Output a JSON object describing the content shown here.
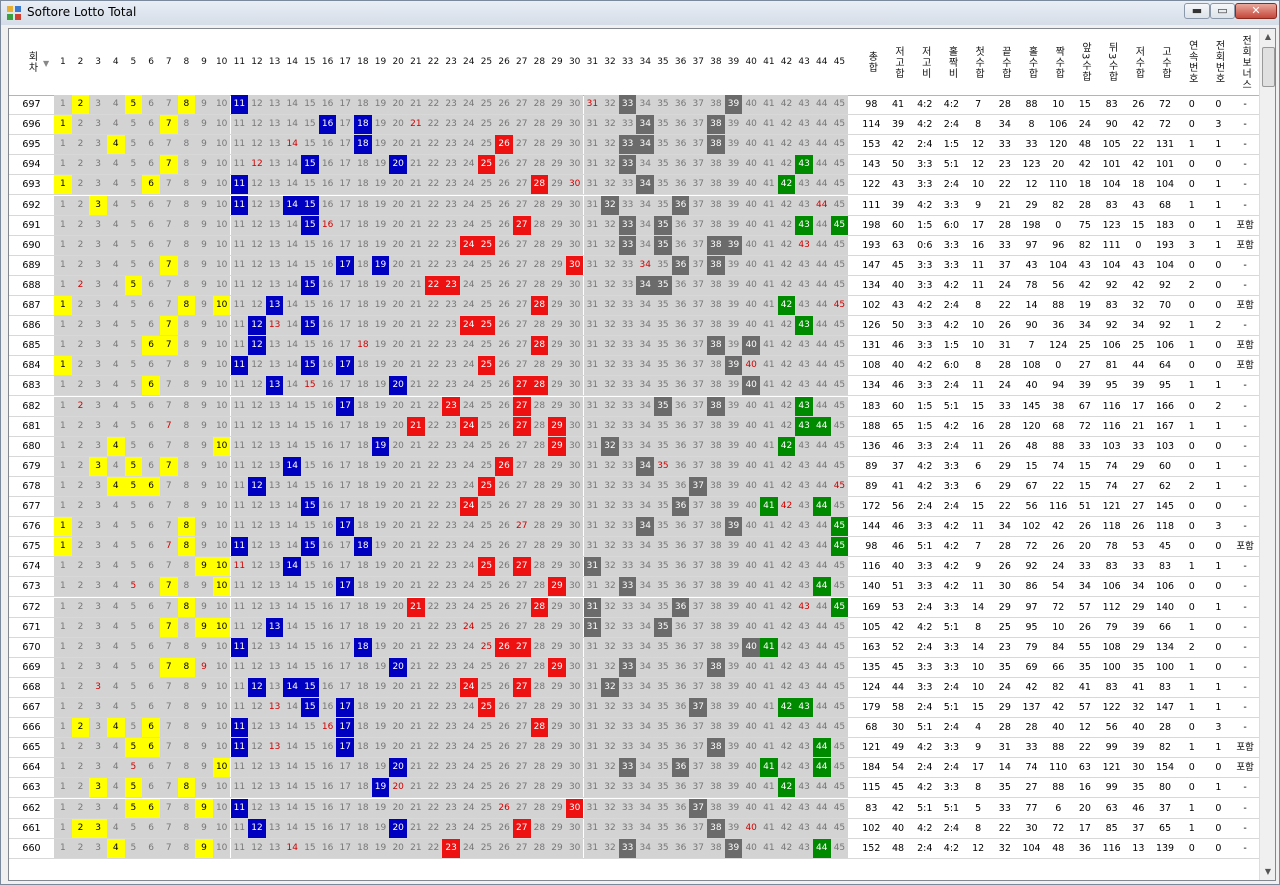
{
  "window": {
    "title": "Softore Lotto Total",
    "min_label": "▬",
    "max_label": "▭",
    "close_label": "✕"
  },
  "columns": {
    "round": "회차",
    "numbers": [
      "1",
      "2",
      "3",
      "4",
      "5",
      "6",
      "7",
      "8",
      "9",
      "10",
      "11",
      "12",
      "13",
      "14",
      "15",
      "16",
      "17",
      "18",
      "19",
      "20",
      "21",
      "22",
      "23",
      "24",
      "25",
      "26",
      "27",
      "28",
      "29",
      "30",
      "31",
      "32",
      "33",
      "34",
      "35",
      "36",
      "37",
      "38",
      "39",
      "40",
      "41",
      "42",
      "43",
      "44",
      "45"
    ],
    "stats": [
      "총합",
      "저고합",
      "저고비",
      "홀짝비",
      "첫수합",
      "끝수합",
      "홀수합",
      "짝수합",
      "앞3수합",
      "뒤3수합",
      "저수합",
      "고수합",
      "연속번호",
      "전회번호",
      "전회보너스"
    ]
  },
  "legend_colors": {
    "y": "#ffff00",
    "b": "#0000c0",
    "r": "#ee1111",
    "g": "#6b6b6b",
    "gr": "#008a00"
  },
  "rows": [
    {
      "round": "697",
      "hits": {
        "2": "y",
        "5": "y",
        "8": "y",
        "11": "b",
        "33": "g",
        "39": "g"
      },
      "red": [
        31
      ],
      "stats": [
        "98",
        "41",
        "4:2",
        "4:2",
        "7",
        "28",
        "88",
        "10",
        "15",
        "83",
        "26",
        "72",
        "0",
        "0",
        "-"
      ]
    },
    {
      "round": "696",
      "hits": {
        "1": "y",
        "7": "y",
        "16": "b",
        "18": "b",
        "34": "g",
        "38": "g"
      },
      "red": [
        21
      ],
      "stats": [
        "114",
        "39",
        "4:2",
        "2:4",
        "8",
        "34",
        "8",
        "106",
        "24",
        "90",
        "42",
        "72",
        "0",
        "3",
        "-"
      ]
    },
    {
      "round": "695",
      "hits": {
        "4": "y",
        "18": "b",
        "26": "r",
        "33": "g",
        "34": "g",
        "38": "g"
      },
      "red": [
        14
      ],
      "stats": [
        "153",
        "42",
        "2:4",
        "1:5",
        "12",
        "33",
        "33",
        "120",
        "48",
        "105",
        "22",
        "131",
        "1",
        "1",
        "-"
      ]
    },
    {
      "round": "694",
      "hits": {
        "7": "y",
        "15": "b",
        "20": "b",
        "25": "r",
        "33": "g",
        "43": "gr"
      },
      "red": [
        12
      ],
      "stats": [
        "143",
        "50",
        "3:3",
        "5:1",
        "12",
        "23",
        "123",
        "20",
        "42",
        "101",
        "42",
        "101",
        "0",
        "0",
        "-"
      ]
    },
    {
      "round": "693",
      "hits": {
        "1": "y",
        "6": "y",
        "11": "b",
        "28": "r",
        "34": "g",
        "42": "gr"
      },
      "red": [
        30
      ],
      "stats": [
        "122",
        "43",
        "3:3",
        "2:4",
        "10",
        "22",
        "12",
        "110",
        "18",
        "104",
        "18",
        "104",
        "0",
        "1",
        "-"
      ]
    },
    {
      "round": "692",
      "hits": {
        "3": "y",
        "11": "b",
        "14": "b",
        "15": "b",
        "32": "g",
        "36": "g"
      },
      "red": [
        44
      ],
      "stats": [
        "111",
        "39",
        "4:2",
        "3:3",
        "9",
        "21",
        "29",
        "82",
        "28",
        "83",
        "43",
        "68",
        "1",
        "1",
        "-"
      ]
    },
    {
      "round": "691",
      "hits": {
        "15": "b",
        "27": "r",
        "33": "g",
        "35": "g",
        "43": "gr",
        "45": "gr"
      },
      "red": [
        16
      ],
      "stats": [
        "198",
        "60",
        "1:5",
        "6:0",
        "17",
        "28",
        "198",
        "0",
        "75",
        "123",
        "15",
        "183",
        "0",
        "1",
        "포함"
      ]
    },
    {
      "round": "690",
      "hits": {
        "24": "r",
        "25": "r",
        "33": "g",
        "35": "g",
        "38": "g",
        "39": "g"
      },
      "red": [
        43
      ],
      "stats": [
        "193",
        "63",
        "0:6",
        "3:3",
        "16",
        "33",
        "97",
        "96",
        "82",
        "111",
        "0",
        "193",
        "3",
        "1",
        "포함"
      ]
    },
    {
      "round": "689",
      "hits": {
        "7": "y",
        "17": "b",
        "19": "b",
        "30": "r",
        "36": "g",
        "38": "g"
      },
      "red": [
        34
      ],
      "stats": [
        "147",
        "45",
        "3:3",
        "3:3",
        "11",
        "37",
        "43",
        "104",
        "43",
        "104",
        "43",
        "104",
        "0",
        "0",
        "-"
      ]
    },
    {
      "round": "688",
      "hits": {
        "5": "y",
        "15": "b",
        "22": "r",
        "23": "r",
        "34": "g",
        "35": "g"
      },
      "red": [
        2
      ],
      "stats": [
        "134",
        "40",
        "3:3",
        "4:2",
        "11",
        "24",
        "78",
        "56",
        "42",
        "92",
        "42",
        "92",
        "2",
        "0",
        "-"
      ]
    },
    {
      "round": "687",
      "hits": {
        "1": "y",
        "8": "y",
        "10": "y",
        "13": "b",
        "28": "r",
        "42": "gr"
      },
      "red": [
        45
      ],
      "stats": [
        "102",
        "43",
        "4:2",
        "2:4",
        "8",
        "22",
        "14",
        "88",
        "19",
        "83",
        "32",
        "70",
        "0",
        "0",
        "포함"
      ]
    },
    {
      "round": "686",
      "hits": {
        "7": "y",
        "12": "b",
        "15": "b",
        "24": "r",
        "25": "r",
        "43": "gr"
      },
      "red": [
        13
      ],
      "stats": [
        "126",
        "50",
        "3:3",
        "4:2",
        "10",
        "26",
        "90",
        "36",
        "34",
        "92",
        "34",
        "92",
        "1",
        "2",
        "-"
      ]
    },
    {
      "round": "685",
      "hits": {
        "6": "y",
        "7": "y",
        "12": "b",
        "28": "r",
        "38": "g",
        "40": "g"
      },
      "red": [
        18
      ],
      "stats": [
        "131",
        "46",
        "3:3",
        "1:5",
        "10",
        "31",
        "7",
        "124",
        "25",
        "106",
        "25",
        "106",
        "1",
        "0",
        "포함"
      ]
    },
    {
      "round": "684",
      "hits": {
        "1": "y",
        "11": "b",
        "15": "b",
        "17": "b",
        "25": "r",
        "39": "g"
      },
      "red": [
        40
      ],
      "stats": [
        "108",
        "40",
        "4:2",
        "6:0",
        "8",
        "28",
        "108",
        "0",
        "27",
        "81",
        "44",
        "64",
        "0",
        "0",
        "포함"
      ]
    },
    {
      "round": "683",
      "hits": {
        "6": "y",
        "13": "b",
        "20": "b",
        "27": "r",
        "28": "r",
        "40": "g"
      },
      "red": [
        15
      ],
      "stats": [
        "134",
        "46",
        "3:3",
        "2:4",
        "11",
        "24",
        "40",
        "94",
        "39",
        "95",
        "39",
        "95",
        "1",
        "1",
        "-"
      ]
    },
    {
      "round": "682",
      "hits": {
        "17": "b",
        "23": "r",
        "27": "r",
        "35": "g",
        "38": "g",
        "43": "gr"
      },
      "red": [
        2
      ],
      "stats": [
        "183",
        "60",
        "1:5",
        "5:1",
        "15",
        "33",
        "145",
        "38",
        "67",
        "116",
        "17",
        "166",
        "0",
        "2",
        "-"
      ]
    },
    {
      "round": "681",
      "hits": {
        "21": "r",
        "24": "r",
        "27": "r",
        "29": "r",
        "43": "gr",
        "44": "gr"
      },
      "red": [
        7
      ],
      "stats": [
        "188",
        "65",
        "1:5",
        "4:2",
        "16",
        "28",
        "120",
        "68",
        "72",
        "116",
        "21",
        "167",
        "1",
        "1",
        "-"
      ]
    },
    {
      "round": "680",
      "hits": {
        "4": "y",
        "10": "y",
        "19": "b",
        "29": "r",
        "32": "g",
        "42": "gr"
      },
      "red": [],
      "stats": [
        "136",
        "46",
        "3:3",
        "2:4",
        "11",
        "26",
        "48",
        "88",
        "33",
        "103",
        "33",
        "103",
        "0",
        "0",
        "-"
      ]
    },
    {
      "round": "679",
      "hits": {
        "3": "y",
        "5": "y",
        "7": "y",
        "14": "b",
        "26": "r",
        "34": "g"
      },
      "red": [
        35
      ],
      "stats": [
        "89",
        "37",
        "4:2",
        "3:3",
        "6",
        "29",
        "15",
        "74",
        "15",
        "74",
        "29",
        "60",
        "0",
        "1",
        "-"
      ]
    },
    {
      "round": "678",
      "hits": {
        "4": "y",
        "5": "y",
        "6": "y",
        "12": "b",
        "25": "r",
        "37": "g"
      },
      "red": [
        45
      ],
      "stats": [
        "89",
        "41",
        "4:2",
        "3:3",
        "6",
        "29",
        "67",
        "22",
        "15",
        "74",
        "27",
        "62",
        "2",
        "1",
        "-"
      ]
    },
    {
      "round": "677",
      "hits": {
        "15": "b",
        "24": "r",
        "36": "g",
        "41": "gr",
        "44": "gr"
      },
      "red": [
        42
      ],
      "stats": [
        "172",
        "56",
        "2:4",
        "2:4",
        "15",
        "22",
        "56",
        "116",
        "51",
        "121",
        "27",
        "145",
        "0",
        "0",
        "-"
      ]
    },
    {
      "round": "676",
      "hits": {
        "1": "y",
        "8": "y",
        "17": "b",
        "34": "g",
        "39": "g",
        "45": "gr"
      },
      "red": [
        27
      ],
      "stats": [
        "144",
        "46",
        "3:3",
        "4:2",
        "11",
        "34",
        "102",
        "42",
        "26",
        "118",
        "26",
        "118",
        "0",
        "3",
        "-"
      ]
    },
    {
      "round": "675",
      "hits": {
        "1": "y",
        "8": "y",
        "11": "b",
        "15": "b",
        "18": "b",
        "45": "gr"
      },
      "red": [
        7
      ],
      "stats": [
        "98",
        "46",
        "5:1",
        "4:2",
        "7",
        "28",
        "72",
        "26",
        "20",
        "78",
        "53",
        "45",
        "0",
        "0",
        "포함"
      ]
    },
    {
      "round": "674",
      "hits": {
        "9": "y",
        "10": "y",
        "14": "b",
        "25": "r",
        "27": "r",
        "31": "g"
      },
      "red": [
        11
      ],
      "stats": [
        "116",
        "40",
        "3:3",
        "4:2",
        "9",
        "26",
        "92",
        "24",
        "33",
        "83",
        "33",
        "83",
        "1",
        "1",
        "-"
      ]
    },
    {
      "round": "673",
      "hits": {
        "7": "y",
        "10": "y",
        "17": "b",
        "29": "r",
        "33": "g",
        "44": "gr"
      },
      "red": [
        5
      ],
      "stats": [
        "140",
        "51",
        "3:3",
        "4:2",
        "11",
        "30",
        "86",
        "54",
        "34",
        "106",
        "34",
        "106",
        "0",
        "0",
        "-"
      ]
    },
    {
      "round": "672",
      "hits": {
        "8": "y",
        "21": "r",
        "28": "r",
        "31": "g",
        "36": "g",
        "45": "gr"
      },
      "red": [
        43
      ],
      "stats": [
        "169",
        "53",
        "2:4",
        "3:3",
        "14",
        "29",
        "97",
        "72",
        "57",
        "112",
        "29",
        "140",
        "0",
        "1",
        "-"
      ]
    },
    {
      "round": "671",
      "hits": {
        "7": "y",
        "9": "y",
        "10": "y",
        "13": "b",
        "31": "g",
        "35": "g"
      },
      "red": [
        24
      ],
      "stats": [
        "105",
        "42",
        "4:2",
        "5:1",
        "8",
        "25",
        "95",
        "10",
        "26",
        "79",
        "39",
        "66",
        "1",
        "0",
        "-"
      ]
    },
    {
      "round": "670",
      "hits": {
        "11": "b",
        "18": "b",
        "26": "r",
        "27": "r",
        "40": "g",
        "41": "gr"
      },
      "red": [
        25
      ],
      "stats": [
        "163",
        "52",
        "2:4",
        "3:3",
        "14",
        "23",
        "79",
        "84",
        "55",
        "108",
        "29",
        "134",
        "2",
        "0",
        "-"
      ]
    },
    {
      "round": "669",
      "hits": {
        "7": "y",
        "8": "y",
        "20": "b",
        "29": "r",
        "33": "g",
        "38": "g"
      },
      "red": [
        9
      ],
      "stats": [
        "135",
        "45",
        "3:3",
        "3:3",
        "10",
        "35",
        "69",
        "66",
        "35",
        "100",
        "35",
        "100",
        "1",
        "0",
        "-"
      ]
    },
    {
      "round": "668",
      "hits": {
        "12": "b",
        "14": "b",
        "15": "b",
        "24": "r",
        "27": "r",
        "32": "g"
      },
      "red": [
        3
      ],
      "stats": [
        "124",
        "44",
        "3:3",
        "2:4",
        "10",
        "24",
        "42",
        "82",
        "41",
        "83",
        "41",
        "83",
        "1",
        "1",
        "-"
      ]
    },
    {
      "round": "667",
      "hits": {
        "15": "b",
        "17": "b",
        "25": "r",
        "37": "g",
        "42": "gr",
        "43": "gr"
      },
      "red": [
        13
      ],
      "stats": [
        "179",
        "58",
        "2:4",
        "5:1",
        "15",
        "29",
        "137",
        "42",
        "57",
        "122",
        "32",
        "147",
        "1",
        "1",
        "-"
      ]
    },
    {
      "round": "666",
      "hits": {
        "2": "y",
        "4": "y",
        "6": "y",
        "11": "b",
        "17": "b",
        "28": "r"
      },
      "red": [
        16
      ],
      "stats": [
        "68",
        "30",
        "5:1",
        "2:4",
        "4",
        "28",
        "28",
        "40",
        "12",
        "56",
        "40",
        "28",
        "0",
        "3",
        "-"
      ]
    },
    {
      "round": "665",
      "hits": {
        "5": "y",
        "6": "y",
        "11": "b",
        "17": "b",
        "38": "g",
        "44": "gr"
      },
      "red": [
        13
      ],
      "stats": [
        "121",
        "49",
        "4:2",
        "3:3",
        "9",
        "31",
        "33",
        "88",
        "22",
        "99",
        "39",
        "82",
        "1",
        "1",
        "포함"
      ]
    },
    {
      "round": "664",
      "hits": {
        "10": "y",
        "20": "b",
        "33": "g",
        "36": "g",
        "41": "gr",
        "44": "gr"
      },
      "red": [
        5
      ],
      "stats": [
        "184",
        "54",
        "2:4",
        "2:4",
        "17",
        "14",
        "74",
        "110",
        "63",
        "121",
        "30",
        "154",
        "0",
        "0",
        "포함"
      ]
    },
    {
      "round": "663",
      "hits": {
        "3": "y",
        "5": "y",
        "8": "y",
        "19": "b",
        "42": "gr"
      },
      "red": [
        20
      ],
      "stats": [
        "115",
        "45",
        "4:2",
        "3:3",
        "8",
        "35",
        "27",
        "88",
        "16",
        "99",
        "35",
        "80",
        "0",
        "1",
        "-"
      ]
    },
    {
      "round": "662",
      "hits": {
        "5": "y",
        "6": "y",
        "9": "y",
        "11": "b",
        "30": "r",
        "37": "g"
      },
      "red": [
        26
      ],
      "stats": [
        "83",
        "42",
        "5:1",
        "5:1",
        "5",
        "33",
        "77",
        "6",
        "20",
        "63",
        "46",
        "37",
        "1",
        "0",
        "-"
      ]
    },
    {
      "round": "661",
      "hits": {
        "2": "y",
        "3": "y",
        "12": "b",
        "20": "b",
        "27": "r",
        "38": "g"
      },
      "red": [
        40
      ],
      "stats": [
        "102",
        "40",
        "4:2",
        "2:4",
        "8",
        "22",
        "30",
        "72",
        "17",
        "85",
        "37",
        "65",
        "1",
        "0",
        "-"
      ]
    },
    {
      "round": "660",
      "hits": {
        "4": "y",
        "9": "y",
        "23": "r",
        "33": "g",
        "39": "g",
        "44": "gr"
      },
      "red": [
        14
      ],
      "stats": [
        "152",
        "48",
        "2:4",
        "4:2",
        "12",
        "32",
        "104",
        "48",
        "36",
        "116",
        "13",
        "139",
        "0",
        "0",
        "-"
      ]
    }
  ]
}
